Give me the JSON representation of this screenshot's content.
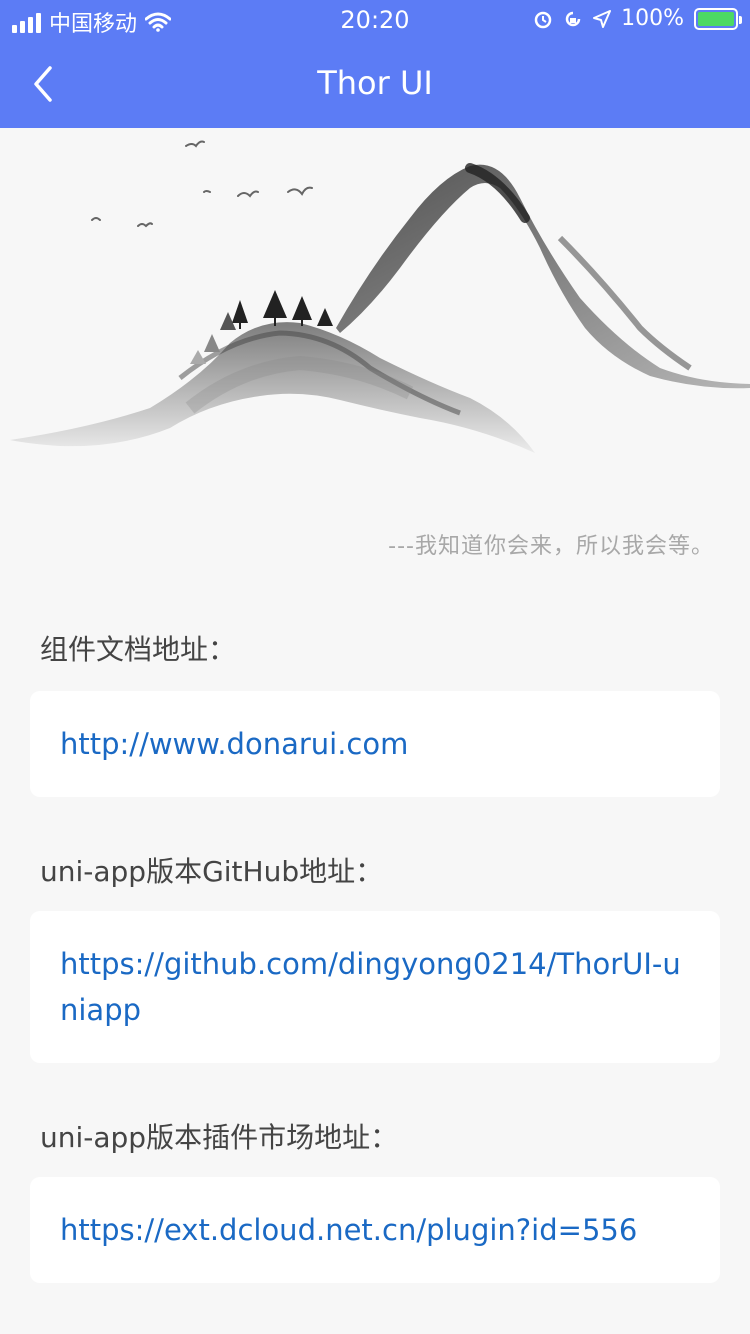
{
  "status": {
    "carrier": "中国移动",
    "time": "20:20",
    "battery": "100%"
  },
  "nav": {
    "title": "Thor UI"
  },
  "hero": {
    "quote": "---我知道你会来，所以我会等。"
  },
  "sections": [
    {
      "label": "组件文档地址：",
      "link": "http://www.donarui.com"
    },
    {
      "label": "uni-app版本GitHub地址：",
      "link": "https://github.com/dingyong0214/ThorUI-uniapp"
    },
    {
      "label": "uni-app版本插件市场地址：",
      "link": "https://ext.dcloud.net.cn/plugin?id=556"
    }
  ],
  "colors": {
    "nav_bg": "#5c7cf5",
    "link": "#1a69c4",
    "page_bg": "#f7f7f7"
  }
}
